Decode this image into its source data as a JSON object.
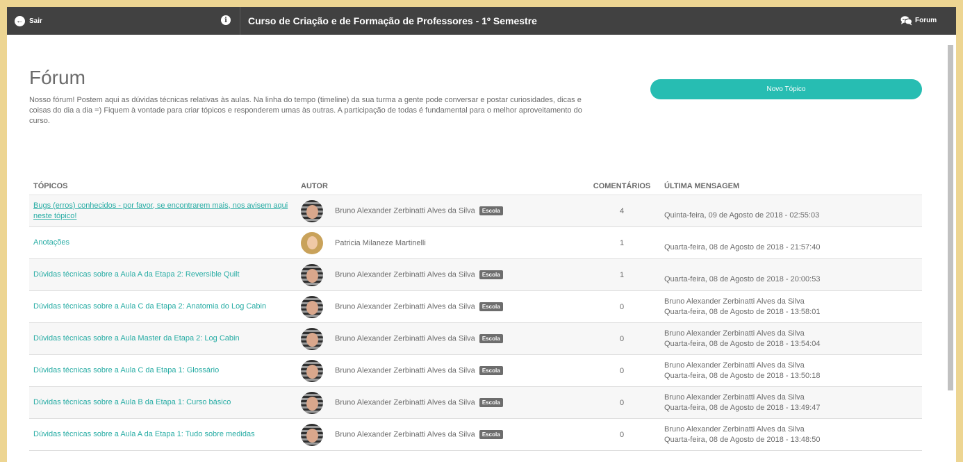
{
  "header": {
    "back_label": "Sair",
    "course_title": "Curso de Criação e de Formação de Professores - 1º Semestre",
    "forum_label": "Forum"
  },
  "page": {
    "title": "Fórum",
    "description": "Nosso fórum! Postem aqui as dúvidas técnicas relativas às aulas. Na linha do tempo (timeline) da sua turma a gente pode conversar e postar curiosidades, dicas e coisas do dia a dia =) Fiquem à vontade para criar tópicos e responderem umas às outras. A participação de todas é fundamental para o melhor aproveitamento do curso.",
    "new_topic_label": "Novo Tópico"
  },
  "table": {
    "headers": {
      "topics": "TÓPICOS",
      "author": "AUTOR",
      "comments": "COMENTÁRIOS",
      "last_message": "ÚLTIMA MENSAGEM"
    },
    "rows": [
      {
        "topic": "Bugs (erros) conhecidos - por favor, se encontrarem mais, nos avisem aqui neste tópico!",
        "author": "Bruno Alexander Zerbinatti Alves da Silva",
        "badge": "Escola",
        "comments": "4",
        "last_by": "",
        "last_when": "Quinta-feira, 09 de Agosto de 2018 - 02:55:03"
      },
      {
        "topic": "Anotações",
        "author": "Patricia Milaneze Martinelli",
        "badge": "",
        "comments": "1",
        "last_by": "",
        "last_when": "Quarta-feira, 08 de Agosto de 2018 - 21:57:40"
      },
      {
        "topic": "Dúvidas técnicas sobre a Aula A da Etapa 2: Reversible Quilt",
        "author": "Bruno Alexander Zerbinatti Alves da Silva",
        "badge": "Escola",
        "comments": "1",
        "last_by": "",
        "last_when": "Quarta-feira, 08 de Agosto de 2018 - 20:00:53"
      },
      {
        "topic": "Dúvidas técnicas sobre a Aula C da Etapa 2: Anatomia do Log Cabin",
        "author": "Bruno Alexander Zerbinatti Alves da Silva",
        "badge": "Escola",
        "comments": "0",
        "last_by": "Bruno Alexander Zerbinatti Alves da Silva",
        "last_when": "Quarta-feira, 08 de Agosto de 2018 - 13:58:01"
      },
      {
        "topic": "Dúvidas técnicas sobre a Aula Master da Etapa 2: Log Cabin",
        "author": "Bruno Alexander Zerbinatti Alves da Silva",
        "badge": "Escola",
        "comments": "0",
        "last_by": "Bruno Alexander Zerbinatti Alves da Silva",
        "last_when": "Quarta-feira, 08 de Agosto de 2018 - 13:54:04"
      },
      {
        "topic": "Dúvidas técnicas sobre a Aula C da Etapa 1: Glossário",
        "author": "Bruno Alexander Zerbinatti Alves da Silva",
        "badge": "Escola",
        "comments": "0",
        "last_by": "Bruno Alexander Zerbinatti Alves da Silva",
        "last_when": "Quarta-feira, 08 de Agosto de 2018 - 13:50:18"
      },
      {
        "topic": "Dúvidas técnicas sobre a Aula B da Etapa 1: Curso básico",
        "author": "Bruno Alexander Zerbinatti Alves da Silva",
        "badge": "Escola",
        "comments": "0",
        "last_by": "Bruno Alexander Zerbinatti Alves da Silva",
        "last_when": "Quarta-feira, 08 de Agosto de 2018 - 13:49:47"
      },
      {
        "topic": "Dúvidas técnicas sobre a Aula A da Etapa 1: Tudo sobre medidas",
        "author": "Bruno Alexander Zerbinatti Alves da Silva",
        "badge": "Escola",
        "comments": "0",
        "last_by": "Bruno Alexander Zerbinatti Alves da Silva",
        "last_when": "Quarta-feira, 08 de Agosto de 2018 - 13:48:50"
      }
    ]
  },
  "colors": {
    "accent": "#27bdb2",
    "topbar": "#414141",
    "page_border": "#edd592"
  }
}
